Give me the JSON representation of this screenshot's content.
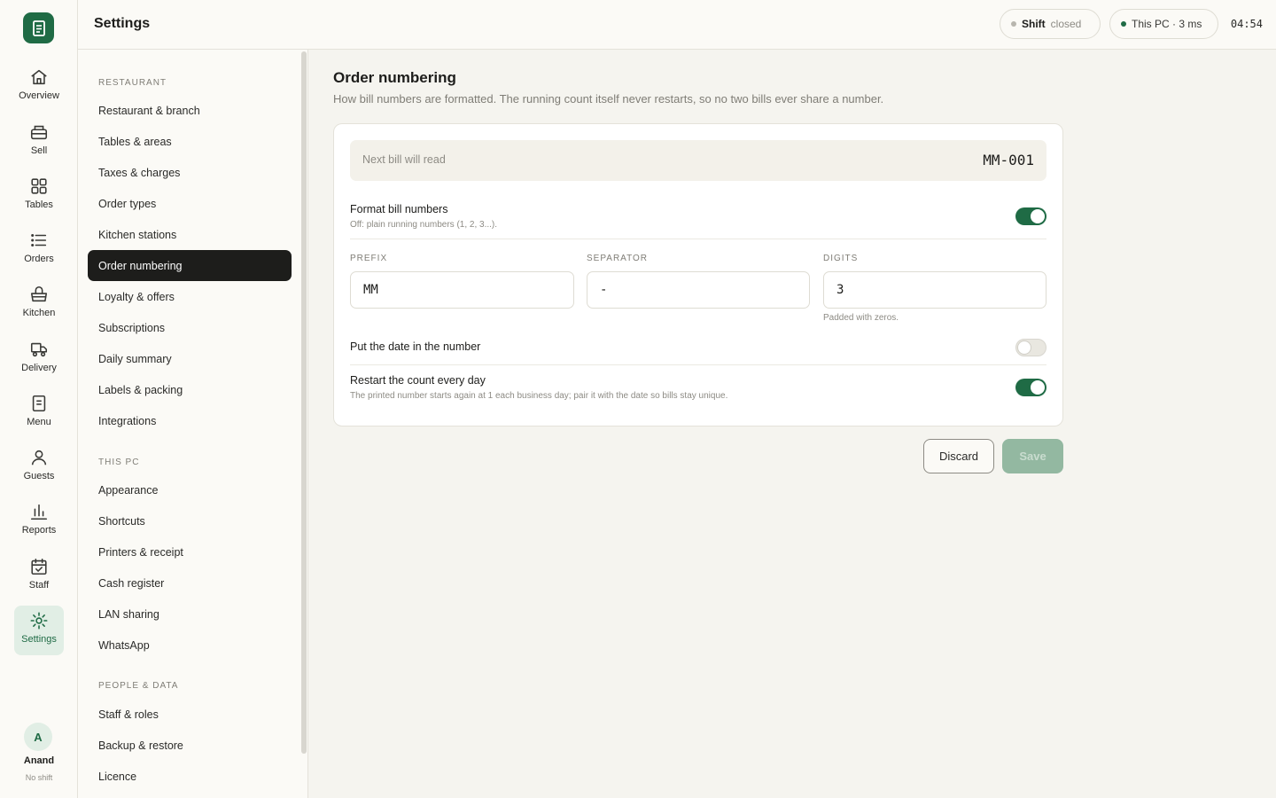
{
  "rail": {
    "items": [
      {
        "label": "Overview",
        "icon": "home-icon"
      },
      {
        "label": "Sell",
        "icon": "register-icon"
      },
      {
        "label": "Tables",
        "icon": "grid-icon"
      },
      {
        "label": "Orders",
        "icon": "list-icon"
      },
      {
        "label": "Kitchen",
        "icon": "basket-icon"
      },
      {
        "label": "Delivery",
        "icon": "truck-icon"
      },
      {
        "label": "Menu",
        "icon": "document-icon"
      },
      {
        "label": "Guests",
        "icon": "person-icon"
      },
      {
        "label": "Reports",
        "icon": "bar-chart-icon"
      },
      {
        "label": "Staff",
        "icon": "calendar-check-icon"
      },
      {
        "label": "Settings",
        "icon": "gear-icon"
      }
    ],
    "active": "Settings",
    "user": {
      "initial": "A",
      "name": "Anand",
      "status": "No shift"
    }
  },
  "header": {
    "title": "Settings",
    "shift_label": "Shift",
    "shift_state": "closed",
    "pc_status": "This PC · 3 ms",
    "clock": "04:54"
  },
  "subnav": {
    "sections": [
      {
        "title": "RESTAURANT",
        "items": [
          "Restaurant & branch",
          "Tables & areas",
          "Taxes & charges",
          "Order types",
          "Kitchen stations",
          "Order numbering",
          "Loyalty & offers",
          "Subscriptions",
          "Daily summary",
          "Labels & packing",
          "Integrations"
        ]
      },
      {
        "title": "THIS PC",
        "items": [
          "Appearance",
          "Shortcuts",
          "Printers & receipt",
          "Cash register",
          "LAN sharing",
          "WhatsApp"
        ]
      },
      {
        "title": "PEOPLE & DATA",
        "items": [
          "Staff & roles",
          "Backup & restore",
          "Licence"
        ]
      }
    ],
    "active": "Order numbering"
  },
  "main": {
    "title": "Order numbering",
    "description": "How bill numbers are formatted. The running count itself never restarts, so no two bills ever share a number.",
    "preview": {
      "label": "Next bill will read",
      "value": "MM-001"
    },
    "format": {
      "label": "Format bill numbers",
      "sub": "Off: plain running numbers (1, 2, 3...).",
      "on": true
    },
    "fields": {
      "prefix": {
        "label": "PREFIX",
        "value": "MM"
      },
      "separator": {
        "label": "SEPARATOR",
        "value": "-"
      },
      "digits": {
        "label": "DIGITS",
        "value": "3",
        "hint": "Padded with zeros."
      }
    },
    "date_in_number": {
      "label": "Put the date in the number",
      "on": false
    },
    "restart_daily": {
      "label": "Restart the count every day",
      "sub": "The printed number starts again at 1 each business day; pair it with the date so bills stay unique.",
      "on": true
    },
    "buttons": {
      "discard": "Discard",
      "save": "Save"
    }
  },
  "colors": {
    "accent": "#1f6b45",
    "accent_soft": "#e1eee5",
    "background": "#f5f4ef"
  }
}
